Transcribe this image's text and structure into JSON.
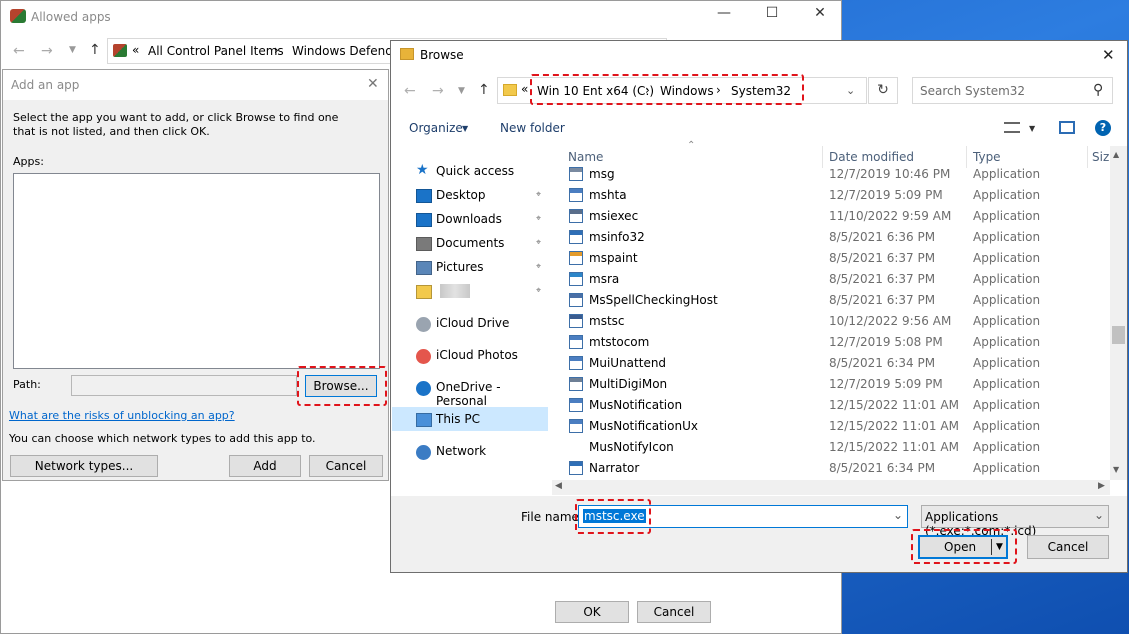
{
  "allowed_apps": {
    "title": "Allowed apps",
    "breadcrumb": [
      "«",
      "All Control Panel Items",
      "›",
      "Windows Defender"
    ],
    "ok_label": "OK",
    "cancel_label": "Cancel"
  },
  "add_app": {
    "title": "Add an app",
    "instructions": "Select the app you want to add, or click Browse to find one that is not listed, and then click OK.",
    "apps_label": "Apps:",
    "path_label": "Path:",
    "path_value": "",
    "browse_label": "Browse...",
    "risks_link": "What are the risks of unblocking an app?",
    "network_text": "You can choose which network types to add this app to.",
    "network_types_label": "Network types...",
    "add_label": "Add",
    "cancel_label": "Cancel"
  },
  "browse": {
    "title": "Browse",
    "address": {
      "prefix": "«",
      "parts": [
        "Win 10 Ent x64 (C:)",
        "Windows",
        "System32"
      ]
    },
    "search_placeholder": "Search System32",
    "organize_label": "Organize",
    "new_folder_label": "New folder",
    "nav": [
      {
        "label": "Quick access",
        "icon": "star-icon"
      },
      {
        "label": "Desktop",
        "icon": "desktop-icon",
        "pinned": true
      },
      {
        "label": "Downloads",
        "icon": "download-icon",
        "pinned": true
      },
      {
        "label": "Documents",
        "icon": "documents-icon",
        "pinned": true
      },
      {
        "label": "Pictures",
        "icon": "pictures-icon",
        "pinned": true
      },
      {
        "label": "",
        "icon": "folder-icon",
        "pinned": true
      },
      {
        "label": "iCloud Drive",
        "icon": "icloud-icon"
      },
      {
        "label": "iCloud Photos",
        "icon": "icloud-photos-icon"
      },
      {
        "label": "OneDrive - Personal",
        "icon": "onedrive-icon"
      },
      {
        "label": "This PC",
        "icon": "pc-icon",
        "selected": true
      },
      {
        "label": "Network",
        "icon": "network-icon"
      }
    ],
    "columns": [
      "Name",
      "Date modified",
      "Type",
      "Size"
    ],
    "files": [
      {
        "name": "msg",
        "date": "12/7/2019 10:46 PM",
        "type": "Application"
      },
      {
        "name": "mshta",
        "date": "12/7/2019 5:09 PM",
        "type": "Application"
      },
      {
        "name": "msiexec",
        "date": "11/10/2022 9:59 AM",
        "type": "Application"
      },
      {
        "name": "msinfo32",
        "date": "8/5/2021 6:36 PM",
        "type": "Application"
      },
      {
        "name": "mspaint",
        "date": "8/5/2021 6:37 PM",
        "type": "Application"
      },
      {
        "name": "msra",
        "date": "8/5/2021 6:37 PM",
        "type": "Application"
      },
      {
        "name": "MsSpellCheckingHost",
        "date": "8/5/2021 6:37 PM",
        "type": "Application"
      },
      {
        "name": "mstsc",
        "date": "10/12/2022 9:56 AM",
        "type": "Application"
      },
      {
        "name": "mtstocom",
        "date": "12/7/2019 5:08 PM",
        "type": "Application"
      },
      {
        "name": "MuiUnattend",
        "date": "8/5/2021 6:34 PM",
        "type": "Application"
      },
      {
        "name": "MultiDigiMon",
        "date": "12/7/2019 5:09 PM",
        "type": "Application"
      },
      {
        "name": "MusNotification",
        "date": "12/15/2022 11:01 AM",
        "type": "Application"
      },
      {
        "name": "MusNotificationUx",
        "date": "12/15/2022 11:01 AM",
        "type": "Application"
      },
      {
        "name": "MusNotifyIcon",
        "date": "12/15/2022 11:01 AM",
        "type": "Application"
      },
      {
        "name": "Narrator",
        "date": "8/5/2021 6:34 PM",
        "type": "Application"
      }
    ],
    "file_name_label": "File name:",
    "file_name_value": "mstsc.exe",
    "file_type_value": "Applications (*.exe;*.com;*.icd)",
    "open_label": "Open",
    "cancel_label": "Cancel"
  },
  "colors": {
    "accent": "#0078d7",
    "highlight": "#cce8ff",
    "annotation": "#e0141b",
    "selection": "#0078d7"
  }
}
